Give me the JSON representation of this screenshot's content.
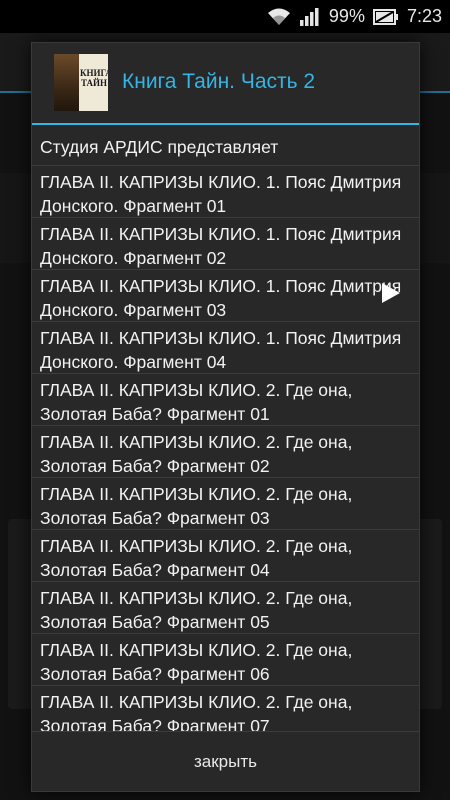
{
  "status_bar": {
    "battery_percent": "99%",
    "time": "7:23"
  },
  "dialog": {
    "title": "Книга Тайн. Часть 2",
    "cover": {
      "title": "КНИГА ТАЙН"
    },
    "items": [
      "Студия АРДИС представляет",
      "ГЛАВА II. КАПРИЗЫ КЛИО. 1. Пояс Дмитрия Донского. Фрагмент 01",
      "ГЛАВА II. КАПРИЗЫ КЛИО. 1. Пояс Дмитрия Донского. Фрагмент 02",
      "ГЛАВА II. КАПРИЗЫ КЛИО. 1. Пояс Дмитрия Донского. Фрагмент 03",
      "ГЛАВА II. КАПРИЗЫ КЛИО. 1. Пояс Дмитрия Донского. Фрагмент 04",
      "ГЛАВА II. КАПРИЗЫ КЛИО. 2. Где она, Золотая Баба? Фрагмент 01",
      "ГЛАВА II. КАПРИЗЫ КЛИО. 2. Где она, Золотая Баба? Фрагмент 02",
      "ГЛАВА II. КАПРИЗЫ КЛИО. 2. Где она, Золотая Баба? Фрагмент 03",
      "ГЛАВА II. КАПРИЗЫ КЛИО. 2. Где она, Золотая Баба? Фрагмент 04",
      "ГЛАВА II. КАПРИЗЫ КЛИО. 2. Где она, Золотая Баба? Фрагмент 05",
      "ГЛАВА II. КАПРИЗЫ КЛИО. 2. Где она, Золотая Баба? Фрагмент 06",
      "ГЛАВА II. КАПРИЗЫ КЛИО. 2. Где она, Золотая Баба? Фрагмент 07"
    ],
    "close_label": "закрыть"
  },
  "colors": {
    "accent": "#33b5e5",
    "dialog_bg": "#282828"
  },
  "icons": [
    "wifi-icon",
    "signal-icon",
    "battery-icon",
    "play-icon"
  ]
}
